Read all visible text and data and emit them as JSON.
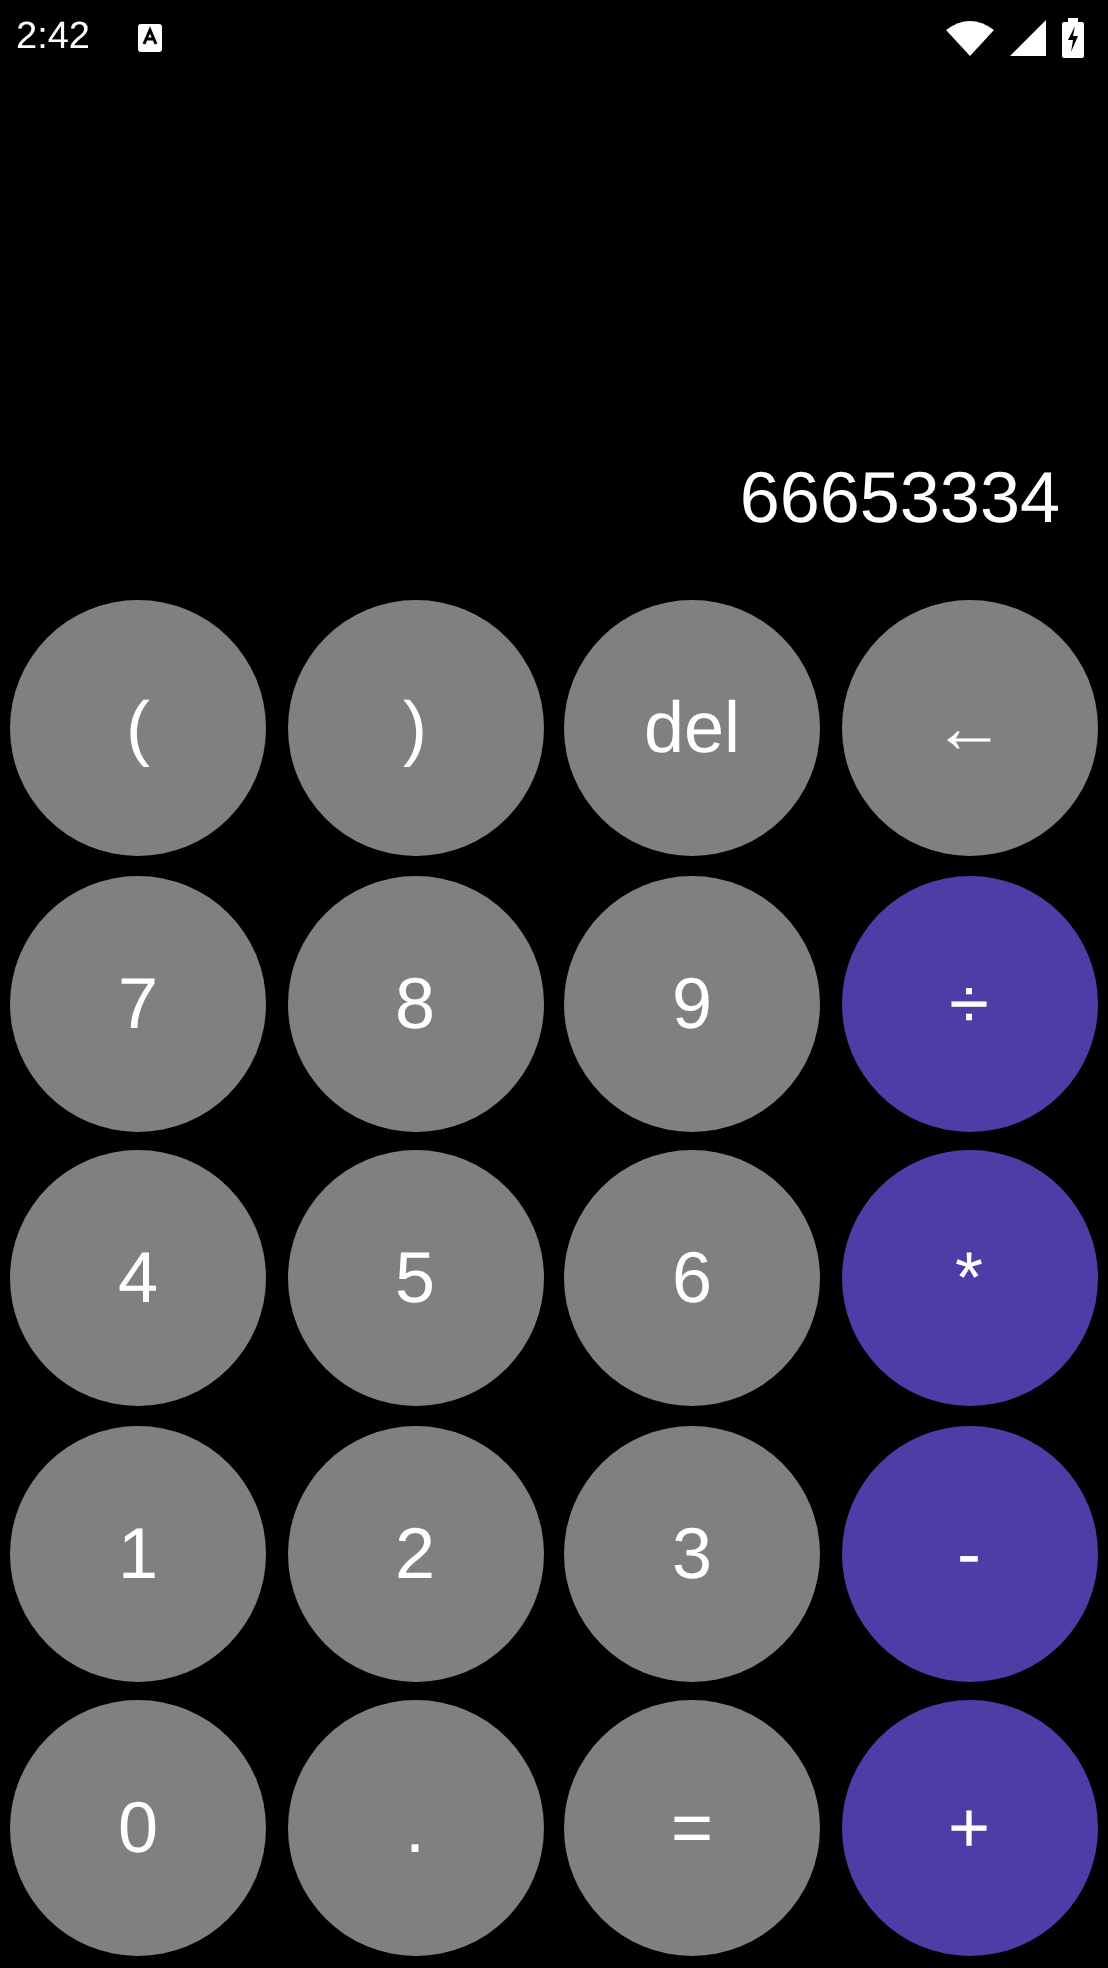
{
  "status_bar": {
    "time": "2:42"
  },
  "display": {
    "value": "66653334"
  },
  "keys": [
    {
      "label": "(",
      "kind": "function"
    },
    {
      "label": ")",
      "kind": "function"
    },
    {
      "label": "del",
      "kind": "function"
    },
    {
      "label": "←",
      "kind": "function"
    },
    {
      "label": "7",
      "kind": "digit"
    },
    {
      "label": "8",
      "kind": "digit"
    },
    {
      "label": "9",
      "kind": "digit"
    },
    {
      "label": "÷",
      "kind": "operator"
    },
    {
      "label": "4",
      "kind": "digit"
    },
    {
      "label": "5",
      "kind": "digit"
    },
    {
      "label": "6",
      "kind": "digit"
    },
    {
      "label": "*",
      "kind": "operator"
    },
    {
      "label": "1",
      "kind": "digit"
    },
    {
      "label": "2",
      "kind": "digit"
    },
    {
      "label": "3",
      "kind": "digit"
    },
    {
      "label": "-",
      "kind": "operator"
    },
    {
      "label": "0",
      "kind": "digit"
    },
    {
      "label": ".",
      "kind": "digit"
    },
    {
      "label": "=",
      "kind": "function"
    },
    {
      "label": "+",
      "kind": "operator"
    }
  ]
}
